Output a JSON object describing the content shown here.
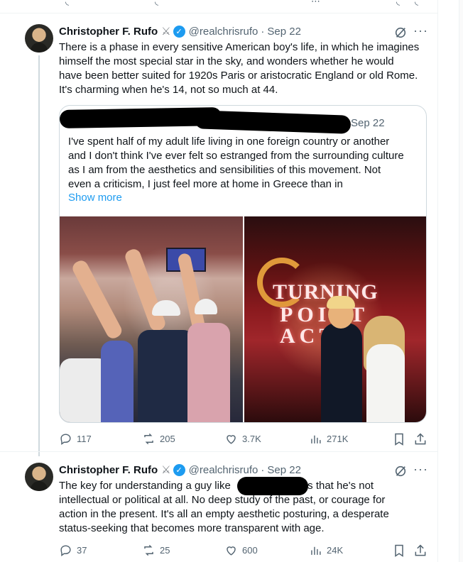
{
  "tweet1": {
    "author_name": "Christopher F. Rufo",
    "name_emoji": "⚔",
    "verified_mark": "✓",
    "handle": "@realchrisrufo",
    "separator": "·",
    "date": "Sep 22",
    "more": "···",
    "text_lines": [
      "There is a phase in every sensitive American boy's life, in which he imagines",
      "himself the most special star in the sky, and wonders whether he would",
      "have been better suited for 1920s Paris or aristocratic England or old Rome.",
      "It's charming when he's 14, not so much at 44."
    ],
    "quote": {
      "date": "Sep 22",
      "text_lines": [
        "I've spent half of my adult life living in one foreign country or another",
        "and I don't think I've ever felt so estranged from the surrounding culture",
        "as I am from the aesthetics and sensibilities of this movement. Not",
        "even a criticism, I just feel more at home in Greece than in"
      ],
      "show_more": "Show more",
      "sign_line1": "TURNING",
      "sign_line2": "POINT ACT"
    },
    "stats": {
      "replies": "117",
      "reposts": "205",
      "likes": "3.7K",
      "views": "271K"
    }
  },
  "tweet2": {
    "author_name": "Christopher F. Rufo",
    "name_emoji": "⚔",
    "verified_mark": "✓",
    "handle": "@realchrisrufo",
    "separator": "·",
    "date": "Sep 22",
    "more": "···",
    "text_lines": [
      "The key for understanding a guy like                          s that he's not",
      "intellectual or political at all. No deep study of the past, or courage for",
      "action in the present. It's all an empty aesthetic posturing, a desperate",
      "status-seeking that becomes more transparent with age."
    ],
    "stats": {
      "replies": "37",
      "reposts": "25",
      "likes": "600",
      "views": "24K"
    }
  },
  "colors": {
    "accent": "#1d9bf0",
    "text": "#0f1419",
    "secondary": "#536471",
    "border": "#cfd9de"
  }
}
